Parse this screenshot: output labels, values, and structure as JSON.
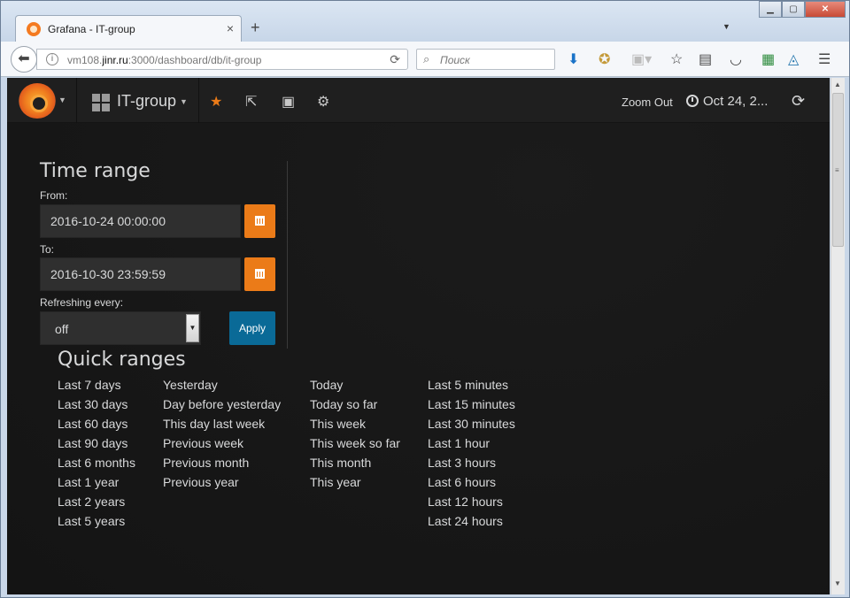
{
  "browser": {
    "tab_title": "Grafana - IT-group",
    "tab_close": "×",
    "new_tab": "+",
    "url_host_prefix": "vm108.",
    "url_host_main": "jinr.ru",
    "url_rest": ":3000/dashboard/db/it-group",
    "search_placeholder": "Поиск",
    "window_buttons": [
      "▁",
      "▢",
      "✕"
    ]
  },
  "grafana": {
    "dashboard_title": "IT-group",
    "zoom_out": "Zoom Out",
    "time_range_summary": "Oct 24, 2...",
    "time_range": {
      "title": "Time range",
      "from_label": "From:",
      "from_value": "2016-10-24 00:00:00",
      "to_label": "To:",
      "to_value": "2016-10-30 23:59:59",
      "refresh_label": "Refreshing every:",
      "refresh_value": "off",
      "apply_label": "Apply"
    },
    "quick_ranges": {
      "title": "Quick ranges",
      "columns": [
        [
          "Last 7 days",
          "Last 30 days",
          "Last 60 days",
          "Last 90 days",
          "Last 6 months",
          "Last 1 year",
          "Last 2 years",
          "Last 5 years"
        ],
        [
          "Yesterday",
          "Day before yesterday",
          "This day last week",
          "Previous week",
          "Previous month",
          "Previous year"
        ],
        [
          "Today",
          "Today so far",
          "This week",
          "This week so far",
          "This month",
          "This year"
        ],
        [
          "Last 5 minutes",
          "Last 15 minutes",
          "Last 30 minutes",
          "Last 1 hour",
          "Last 3 hours",
          "Last 6 hours",
          "Last 12 hours",
          "Last 24 hours"
        ]
      ]
    }
  },
  "colors": {
    "accent_orange": "#eb7b18",
    "apply_blue": "#0a6a97",
    "background": "#161616",
    "text": "#d8d9da"
  }
}
